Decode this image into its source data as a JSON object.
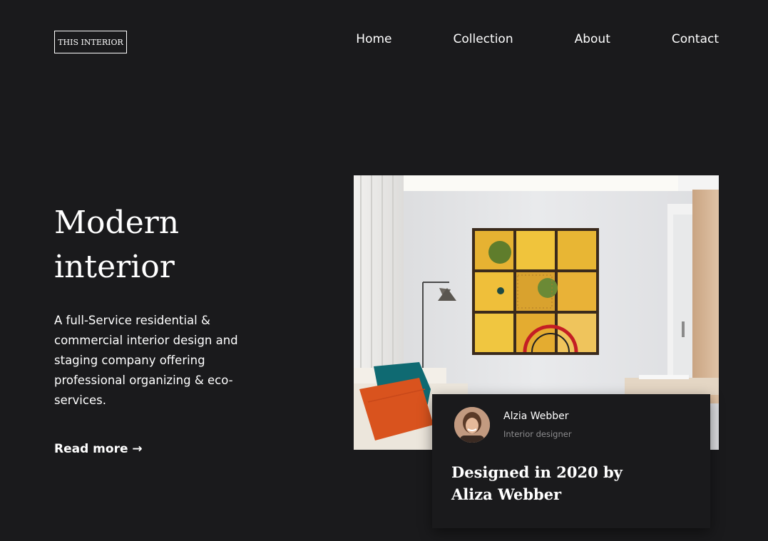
{
  "header": {
    "logo_text": "THIS INTERIOR",
    "nav": [
      {
        "label": "Home"
      },
      {
        "label": "Collection"
      },
      {
        "label": "About"
      },
      {
        "label": "Contact"
      }
    ]
  },
  "hero": {
    "title_line1": "Modern",
    "title_line2": "interior",
    "description": "A full-Service residential & commercial interior design and staging company offering professional organizing & eco-services.",
    "read_more": "Read more →"
  },
  "card": {
    "author_name": "Alzia Webber",
    "author_role": "Interior designer",
    "title_line1": "Designed in 2020 by",
    "title_line2": "Aliza Webber"
  },
  "colors": {
    "background": "#1a1a1c",
    "text": "#ffffff",
    "muted_text": "#8d8d8f",
    "accent_orange": "#d9531e",
    "accent_teal": "#0f6a72",
    "panel_yellow": "#e9b93a"
  }
}
